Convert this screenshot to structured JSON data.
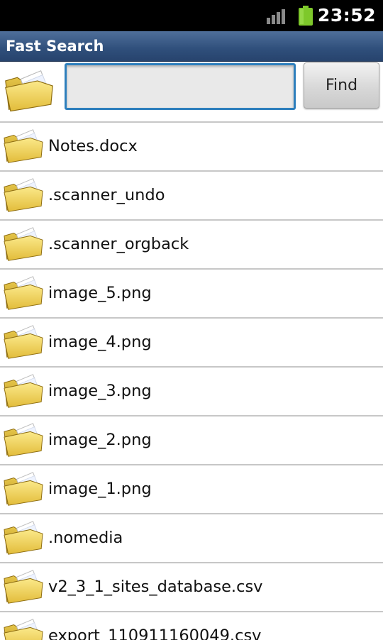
{
  "status_bar": {
    "time": "23:52",
    "signal_icon": "signal-bars-icon",
    "battery_icon": "battery-icon",
    "battery_color": "#7ec82b"
  },
  "title_bar": {
    "title": "Fast Search",
    "color": "#2f4f7b"
  },
  "search": {
    "folder_icon": "folder-icon",
    "query": "",
    "placeholder": "",
    "find_label": "Find",
    "focus_color": "#2e7fbd"
  },
  "files": [
    {
      "name": "Notes.docx",
      "icon": "folder-icon"
    },
    {
      "name": ".scanner_undo",
      "icon": "folder-icon"
    },
    {
      "name": ".scanner_orgback",
      "icon": "folder-icon"
    },
    {
      "name": "image_5.png",
      "icon": "folder-icon"
    },
    {
      "name": "image_4.png",
      "icon": "folder-icon"
    },
    {
      "name": "image_3.png",
      "icon": "folder-icon"
    },
    {
      "name": "image_2.png",
      "icon": "folder-icon"
    },
    {
      "name": "image_1.png",
      "icon": "folder-icon"
    },
    {
      "name": ".nomedia",
      "icon": "folder-icon"
    },
    {
      "name": "v2_3_1_sites_database.csv",
      "icon": "folder-icon"
    },
    {
      "name": "export_110911160049.csv",
      "icon": "folder-icon"
    }
  ]
}
